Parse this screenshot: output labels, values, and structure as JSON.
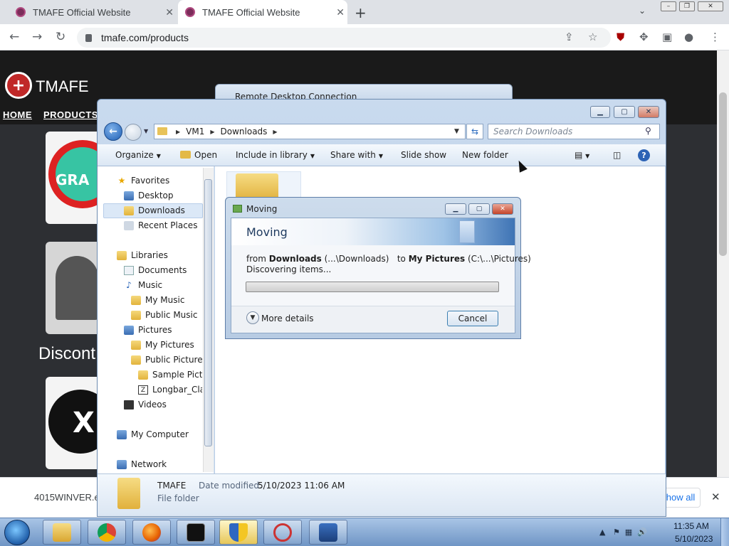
{
  "browser": {
    "tabs": [
      {
        "title": "TMAFE Official Website"
      },
      {
        "title": "TMAFE Official Website"
      }
    ],
    "new_tab": "+",
    "url": "tmafe.com/products"
  },
  "site": {
    "brand": "TMAFE",
    "nav": [
      "HOME",
      "PRODUCTS"
    ],
    "card1_text": "GRA",
    "discont_text": "Discont",
    "card3_text": "X"
  },
  "download_bar": {
    "filename": "4015WINVER.e:",
    "show_all": "how all"
  },
  "rdc": {
    "title": "Remote Desktop Connection"
  },
  "explorer": {
    "breadcrumb": [
      "VM1",
      "Downloads"
    ],
    "search_placeholder": "Search Downloads",
    "commands": {
      "organize": "Organize",
      "open": "Open",
      "include": "Include in library",
      "share": "Share with",
      "slideshow": "Slide show",
      "newfolder": "New folder"
    },
    "nav_items": [
      {
        "label": "Favorites"
      },
      {
        "label": "Desktop"
      },
      {
        "label": "Downloads"
      },
      {
        "label": "Recent Places"
      },
      {
        "label": "Libraries"
      },
      {
        "label": "Documents"
      },
      {
        "label": "Music"
      },
      {
        "label": "My Music"
      },
      {
        "label": "Public Music"
      },
      {
        "label": "Pictures"
      },
      {
        "label": "My Pictures"
      },
      {
        "label": "Public Pictures"
      },
      {
        "label": "Sample Pictu"
      },
      {
        "label": "Longbar_Clas"
      },
      {
        "label": "Videos"
      },
      {
        "label": "My Computer"
      },
      {
        "label": "Network"
      }
    ],
    "details": {
      "name": "TMAFE",
      "modified_label": "Date modified:",
      "modified_value": "5/10/2023 11:06 AM",
      "type": "File folder"
    }
  },
  "dialog": {
    "title": "Moving",
    "heading": "Moving",
    "from_word": "from",
    "from_name": "Downloads",
    "from_path": "(...\\Downloads)",
    "to_word": "to",
    "to_name": "My Pictures",
    "to_path": "(C:\\...\\Pictures)",
    "status": "Discovering items...",
    "progress": 0,
    "more_details": "More details",
    "cancel": "Cancel"
  },
  "taskbar": {
    "time": "11:35 AM",
    "date": "5/10/2023"
  }
}
